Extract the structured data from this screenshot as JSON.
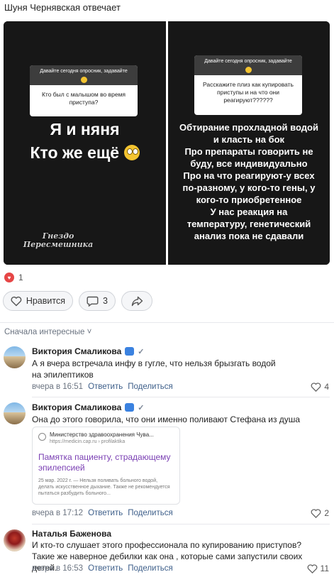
{
  "post": {
    "caption": "Шуня Чернявская отвечает",
    "story_left": {
      "header": "Давайте сегодня опросник, задавайте",
      "question": "Кто был с малышом во время приступа?",
      "answer_line1": "Я и няня",
      "answer_line2": "Кто же ещё",
      "watermark_line1": "Гнездо",
      "watermark_line2": "Пересмешника"
    },
    "story_right": {
      "header": "Давайте сегодня опросник, задавайте",
      "question": "Расскажите плиз как купировать приступы и на что они реагируют??????",
      "answer": [
        "Обтирание прохладной водой",
        "и класть на бок",
        "Про препараты говорить не",
        "буду, все индивидуально",
        "Про на что реагируют-у всех",
        "по-разному, у кого-то гены, у",
        "кого-то приобретенное",
        "У нас реакция на",
        "температуру, генетический",
        "анализ пока не сдавали"
      ]
    },
    "reactions_count": "1",
    "like_label": "Нравится",
    "comments_count": "3",
    "share_icon": "share-arrow-icon"
  },
  "comments_sort": "Сначала интересные",
  "comments": [
    {
      "author": "Виктория Смаликова",
      "text": "А я вчера встречала инфу в гугле, что нельзя брызгать водой на эпилептиков",
      "time": "вчера в 16:51",
      "reply": "Ответить",
      "share": "Поделиться",
      "likes": "4"
    },
    {
      "author": "Виктория Смаликова",
      "text": "Она до этого говорила, что они именно поливают Стефана из душа",
      "link": {
        "site": "Министерство здравоохранения Чува...",
        "url": "https://medicin.cap.ru › profilaktika",
        "title": "Памятка пациенту, страдающему эпилепсией",
        "desc": "25 мар. 2022 г. — Нельзя поливать больного водой, делать искусственное дыхание. Также не рекомендуется пытаться разбудить больного..."
      },
      "time": "вчера в 17:12",
      "reply": "Ответить",
      "share": "Поделиться",
      "likes": "2"
    },
    {
      "author": "Наталья Баженова",
      "text": "И кто-то слушает этого профессионала по купированию приступов? Такие же наверное дебилки как она , которые сами запустили своих детей.",
      "time": "вчера в 16:53",
      "reply": "Ответить",
      "share": "Поделиться",
      "likes": "11"
    }
  ]
}
